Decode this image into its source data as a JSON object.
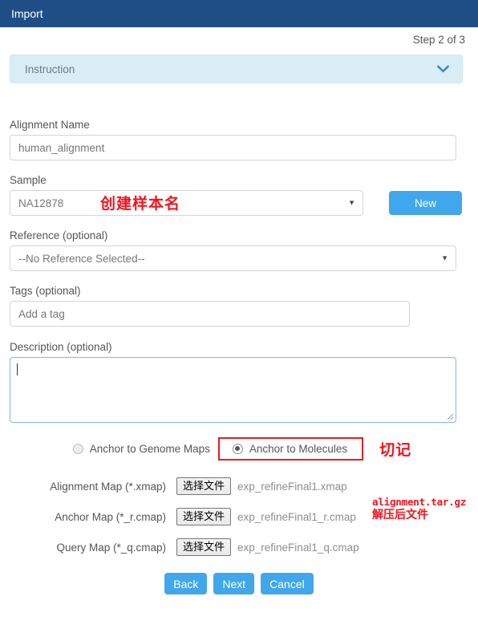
{
  "window": {
    "title": "Import"
  },
  "wizard": {
    "step_text": "Step 2 of 3"
  },
  "instruction": {
    "label": "Instruction",
    "chevron_icon": "chevron-down-icon",
    "chevron_color": "#337ab7",
    "background_color": "#d9edf7"
  },
  "form": {
    "alignment_name": {
      "label": "Alignment Name",
      "value": "human_alignment"
    },
    "sample": {
      "label": "Sample",
      "value": "NA12878",
      "annotation": "创建样本名",
      "new_button": "New"
    },
    "reference": {
      "label": "Reference (optional)",
      "value": "--No Reference Selected--"
    },
    "tags": {
      "label": "Tags (optional)",
      "value": "",
      "placeholder": "Add a tag"
    },
    "description": {
      "label": "Description (optional)",
      "value": ""
    }
  },
  "anchor": {
    "options": [
      {
        "label": "Anchor to Genome Maps",
        "selected": false
      },
      {
        "label": "Anchor to Molecules",
        "selected": true
      }
    ],
    "annotation": "切记",
    "highlight_color": "#e02020"
  },
  "files": {
    "choose_label": "选择文件",
    "rows": [
      {
        "label": "Alignment Map (*.xmap)",
        "filename": "exp_refineFinal1.xmap"
      },
      {
        "label": "Anchor Map (*_r.cmap)",
        "filename": "exp_refineFinal1_r.cmap"
      },
      {
        "label": "Query Map (*_q.cmap)",
        "filename": "exp_refineFinal1_q.cmap"
      }
    ],
    "annotation_line1": "alignment.tar.gz",
    "annotation_line2": "解压后文件"
  },
  "footer": {
    "back": "Back",
    "next": "Next",
    "cancel": "Cancel",
    "button_color": "#41a7ec"
  }
}
